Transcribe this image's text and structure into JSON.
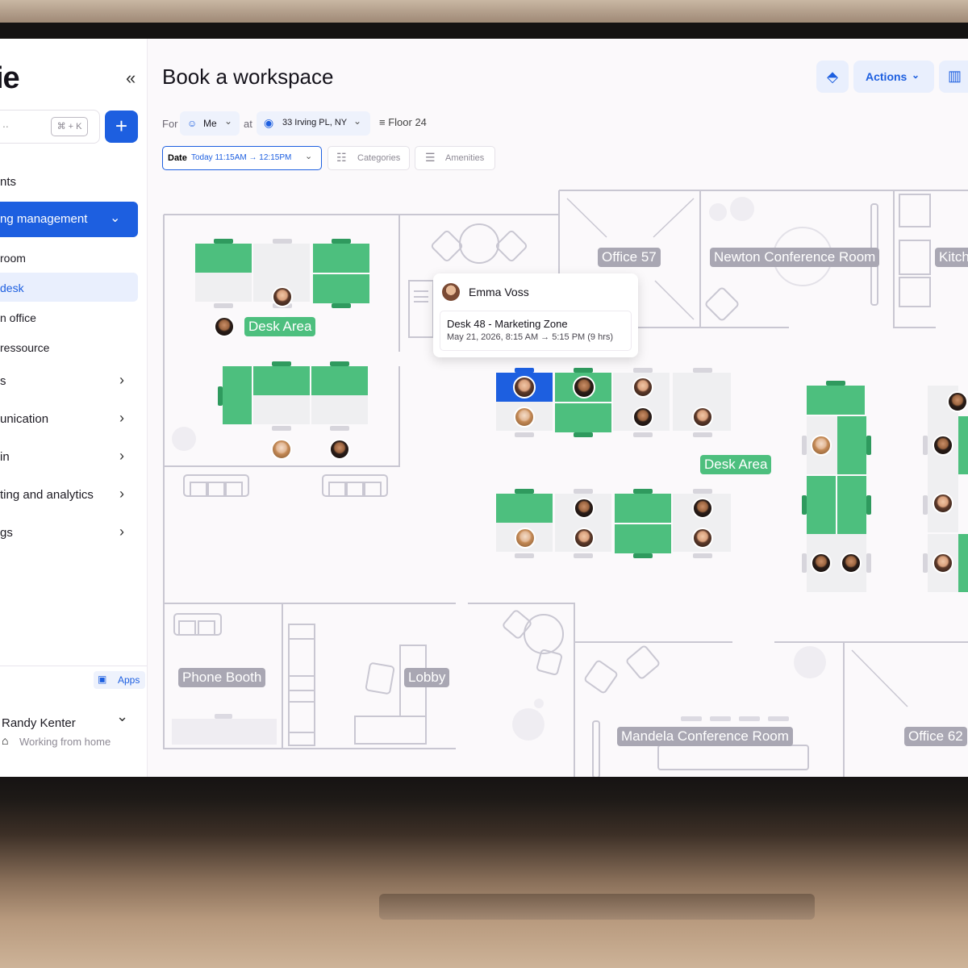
{
  "header": {
    "title": "Book a workspace",
    "actions_label": "Actions"
  },
  "filters": {
    "for_label": "For",
    "for_value": "Me",
    "at_label": "at",
    "location": "33 Irving PL, NY",
    "floor": "Floor 24",
    "date_label": "Date",
    "date_value": "Today 11:15AM → 12:15PM",
    "categories": "Categories",
    "amenities": "Amenities"
  },
  "sidebar": {
    "logo": "ie",
    "search_placeholder": "..",
    "shortcut": "⌘ + K",
    "items": [
      {
        "label": "nts"
      },
      {
        "label": "ng management"
      },
      {
        "label": "room"
      },
      {
        "label": "desk"
      },
      {
        "label": "n office"
      },
      {
        "label": "ressource"
      },
      {
        "label": "s"
      },
      {
        "label": "unication"
      },
      {
        "label": "in"
      },
      {
        "label": "ting and analytics"
      },
      {
        "label": "gs"
      }
    ],
    "apps_label": "Apps",
    "user_name": "Randy Kenter",
    "user_status": "Working from home"
  },
  "plan": {
    "rooms": [
      "Office 57",
      "Newton Conference Room",
      "Kitch",
      "Phone Booth",
      "Lobby",
      "Mandela Conference Room",
      "Office 62"
    ],
    "desk_areas": [
      "Desk Area",
      "Desk Area"
    ]
  },
  "tooltip": {
    "person": "Emma Voss",
    "desk": "Desk 48 - Marketing Zone",
    "time": "May 21, 2026, 8:15 AM → 5:15 PM (9 hrs)"
  },
  "colors": {
    "accent": "#1d5fe0",
    "desk_green": "#4dbf7e",
    "room_label": "#a9a7b3"
  }
}
